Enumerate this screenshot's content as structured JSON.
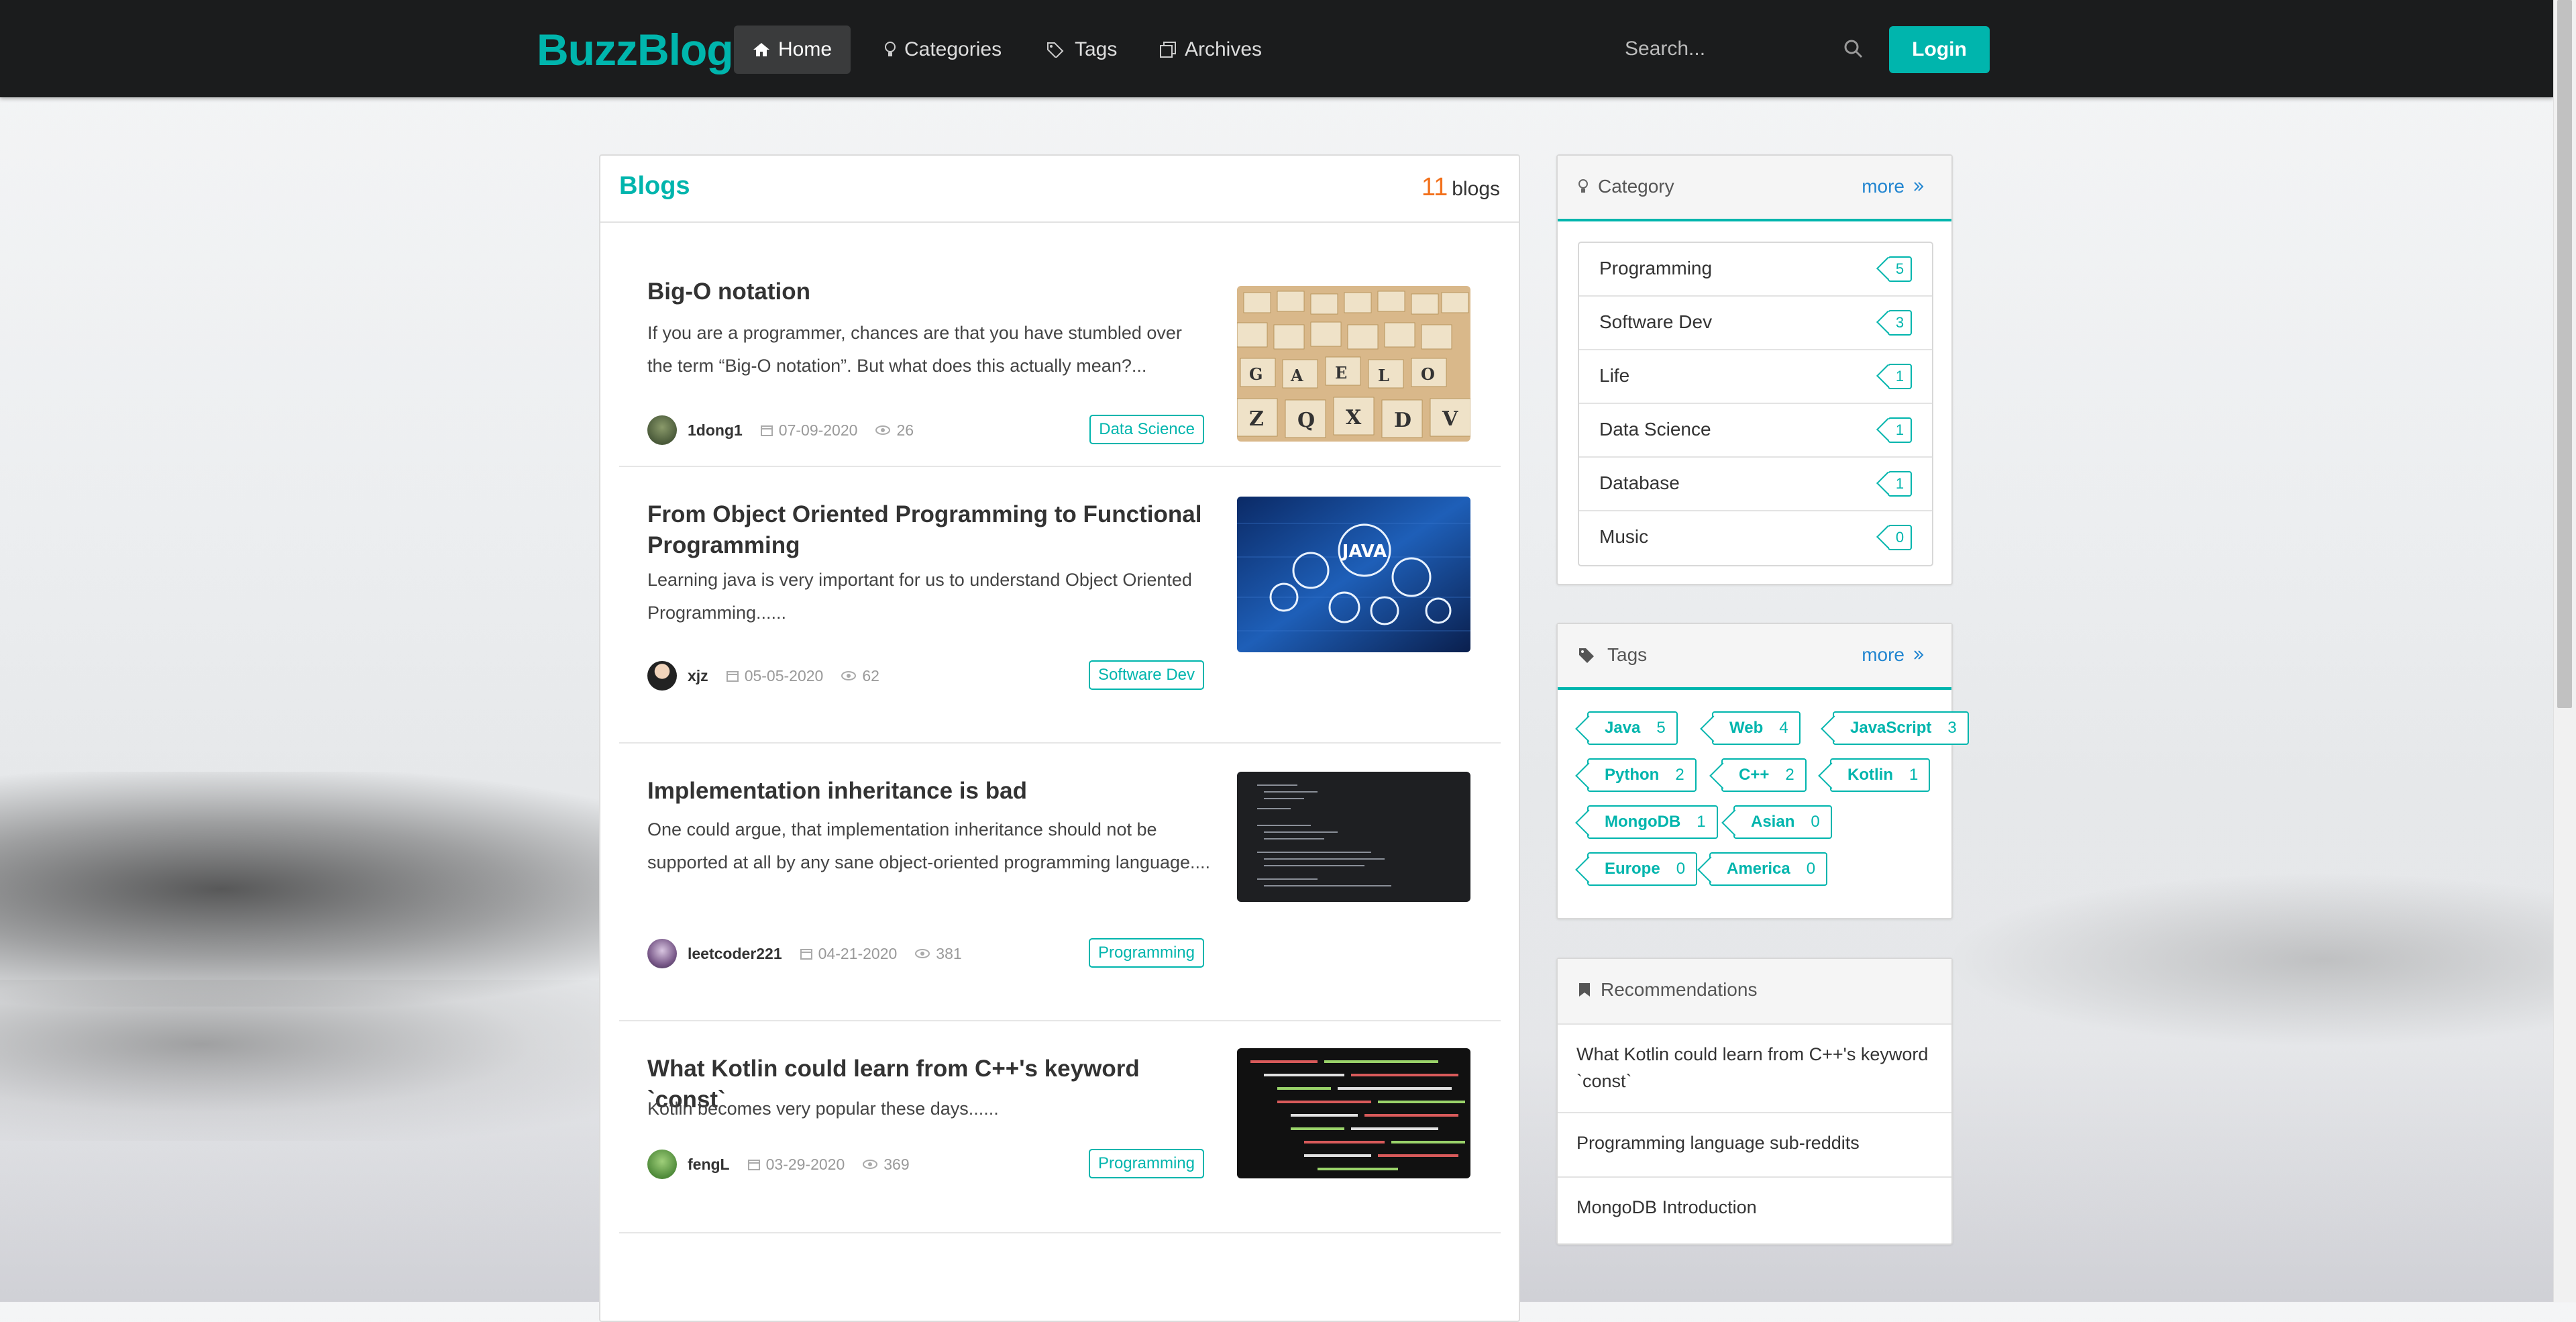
{
  "brand": "BuzzBlog",
  "nav": {
    "items": [
      {
        "label": "Home",
        "icon": "home-icon"
      },
      {
        "label": "Categories",
        "icon": "lightbulb-icon"
      },
      {
        "label": "Tags",
        "icon": "tags-icon"
      },
      {
        "label": "Archives",
        "icon": "clone-icon"
      }
    ],
    "search_placeholder": "Search...",
    "login_label": "Login"
  },
  "blogs": {
    "title": "Blogs",
    "count": "11",
    "count_suffix": "blogs",
    "posts": [
      {
        "title": "Big-O notation",
        "excerpt": "If you are a programmer, chances are that you have stumbled over the term “Big-O notation”. But what does this actually mean?...",
        "author": "1dong1",
        "date": "07-09-2020",
        "views": "26",
        "category": "Data Science",
        "thumb": "letter-blocks-image"
      },
      {
        "title": "From Object Oriented Programming to Functional Programming",
        "excerpt": "Learning java is very important for us to understand Object Oriented Programming......",
        "author": "xjz",
        "date": "05-05-2020",
        "views": "62",
        "category": "Software Dev",
        "thumb": "java-gears-image"
      },
      {
        "title": "Implementation inheritance is bad",
        "excerpt": "One could argue, that implementation inheritance should not be supported at all by any sane object-oriented programming language....",
        "author": "leetcoder221",
        "date": "04-21-2020",
        "views": "381",
        "category": "Programming",
        "thumb": "code-editor-image"
      },
      {
        "title": "What Kotlin could learn from C++'s keyword `const`",
        "excerpt": "Kotlin becomes very popular these days......",
        "author": "fengL",
        "date": "03-29-2020",
        "views": "369",
        "category": "Programming",
        "thumb": "colored-code-image"
      }
    ]
  },
  "category_card": {
    "title": "Category",
    "more": "more",
    "items": [
      {
        "name": "Programming",
        "count": "5"
      },
      {
        "name": "Software Dev",
        "count": "3"
      },
      {
        "name": "Life",
        "count": "1"
      },
      {
        "name": "Data Science",
        "count": "1"
      },
      {
        "name": "Database",
        "count": "1"
      },
      {
        "name": "Music",
        "count": "0"
      }
    ]
  },
  "tags_card": {
    "title": "Tags",
    "more": "more",
    "items": [
      {
        "name": "Java",
        "count": "5"
      },
      {
        "name": "Web",
        "count": "4"
      },
      {
        "name": "JavaScript",
        "count": "3"
      },
      {
        "name": "Python",
        "count": "2"
      },
      {
        "name": "C++",
        "count": "2"
      },
      {
        "name": "Kotlin",
        "count": "1"
      },
      {
        "name": "MongoDB",
        "count": "1"
      },
      {
        "name": "Asian",
        "count": "0"
      },
      {
        "name": "Europe",
        "count": "0"
      },
      {
        "name": "America",
        "count": "0"
      }
    ]
  },
  "recommendations": {
    "title": "Recommendations",
    "items": [
      "What Kotlin could learn from C++'s keyword `const`",
      "Programming language sub-reddits",
      "MongoDB Introduction"
    ]
  },
  "colors": {
    "accent": "#00b5ad",
    "navbar": "#1b1c1d",
    "link": "#2185d0",
    "count_orange": "#f2711c"
  }
}
